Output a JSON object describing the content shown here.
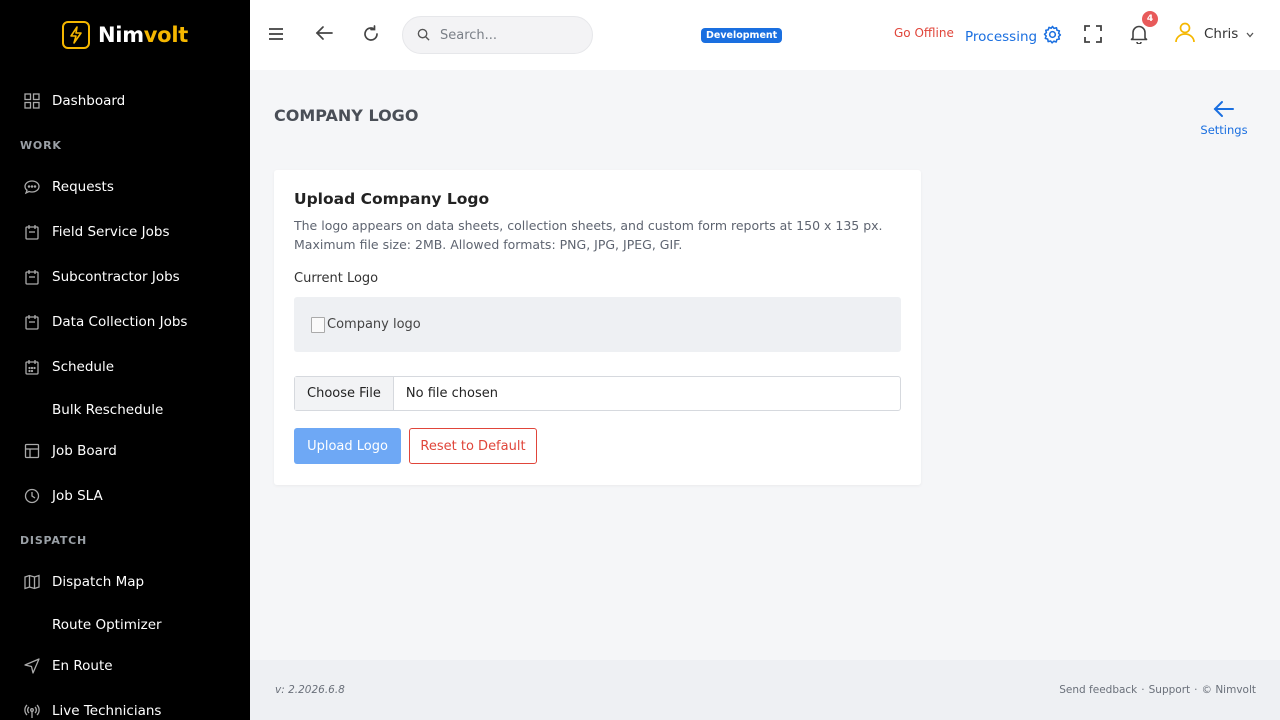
{
  "brand": {
    "name_prefix": "Nim",
    "name_suffix": "volt"
  },
  "sidebar": {
    "dashboard": "Dashboard",
    "section_work": "WORK",
    "requests": "Requests",
    "field_service_jobs": "Field Service Jobs",
    "subcontractor_jobs": "Subcontractor Jobs",
    "data_collection_jobs": "Data Collection Jobs",
    "schedule": "Schedule",
    "bulk_reschedule": "Bulk Reschedule",
    "job_board": "Job Board",
    "job_sla": "Job SLA",
    "section_dispatch": "DISPATCH",
    "dispatch_map": "Dispatch Map",
    "route_optimizer": "Route Optimizer",
    "en_route": "En Route",
    "live_technicians": "Live Technicians"
  },
  "header": {
    "search_placeholder": "Search...",
    "env_badge": "Development",
    "go_offline": "Go Offline",
    "processing": "Processing",
    "notification_count": "4",
    "user_name": "Chris"
  },
  "page": {
    "title": "COMPANY LOGO",
    "settings_link": "Settings"
  },
  "card": {
    "title": "Upload Company Logo",
    "description": "The logo appears on data sheets, collection sheets, and custom form reports at 150 x 135 px. Maximum file size: 2MB. Allowed formats: PNG, JPG, JPEG, GIF.",
    "current_logo_label": "Current Logo",
    "logo_alt": "Company logo",
    "file_button": "Choose File",
    "file_status": "No file chosen",
    "upload_button": "Upload Logo",
    "reset_button": "Reset to Default"
  },
  "footer": {
    "version": "v: 2.2026.6.8",
    "send_feedback": "Send feedback",
    "support": "Support",
    "copyright": "© Nimvolt",
    "separator": "·"
  },
  "colors": {
    "accent": "#1a6fe0",
    "brand_yellow": "#f5b700",
    "danger": "#e0453a",
    "sidebar_bg": "#000000"
  }
}
